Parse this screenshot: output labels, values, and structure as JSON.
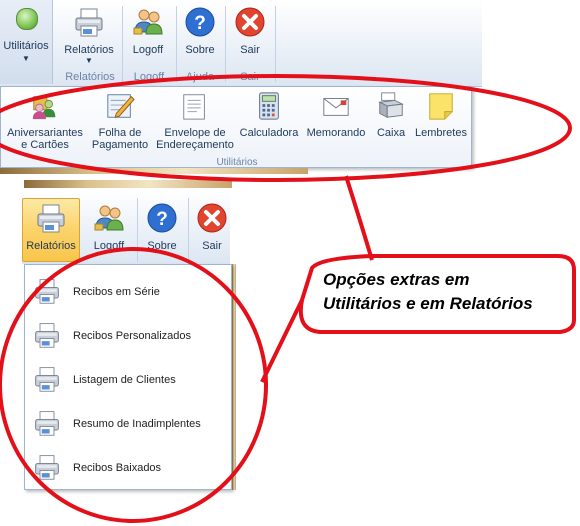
{
  "top_ribbon": {
    "utilitarios_label": "Utilitários",
    "relatorios_label": "Relatórios",
    "logoff_label": "Logoff",
    "sobre_label": "Sobre",
    "sair_label": "Sair",
    "groups": {
      "relatorios": "Relatórios",
      "logoff": "Logoff",
      "ajuda": "Ajuda",
      "sair": "Sair"
    }
  },
  "utilitarios_panel": {
    "title": "Utilitários",
    "items": [
      {
        "line1": "Aniversariantes",
        "line2": "e Cartões",
        "icon": "birthday-people-icon"
      },
      {
        "line1": "Folha de",
        "line2": "Pagamento",
        "icon": "payroll-pencil-icon"
      },
      {
        "line1": "Envelope de",
        "line2": "Endereçamento",
        "icon": "document-envelope-icon"
      },
      {
        "line1": "Calculadora",
        "line2": "",
        "icon": "calculator-icon"
      },
      {
        "line1": "Memorando",
        "line2": "",
        "icon": "memo-envelope-icon"
      },
      {
        "line1": "Caixa",
        "line2": "",
        "icon": "cash-register-icon"
      },
      {
        "line1": "Lembretes",
        "line2": "",
        "icon": "sticky-note-icon"
      }
    ]
  },
  "second_ribbon": {
    "relatorios_label": "Relatórios",
    "logoff_label": "Logoff",
    "sobre_label": "Sobre",
    "sair_label": "Sair"
  },
  "relatorios_menu": {
    "items": [
      "Recibos em Série",
      "Recibos Personalizados",
      "Listagem de Clientes",
      "Resumo de Inadimplentes",
      "Recibos Baixados"
    ]
  },
  "callout": {
    "line1": "Opções extras em",
    "line2": "Utilitários e em Relatórios"
  },
  "colors": {
    "annotation_red": "#e3101a",
    "ribbon_text": "#1e395b",
    "group_label": "#6d83a5",
    "highlight": "#fbd36a"
  }
}
